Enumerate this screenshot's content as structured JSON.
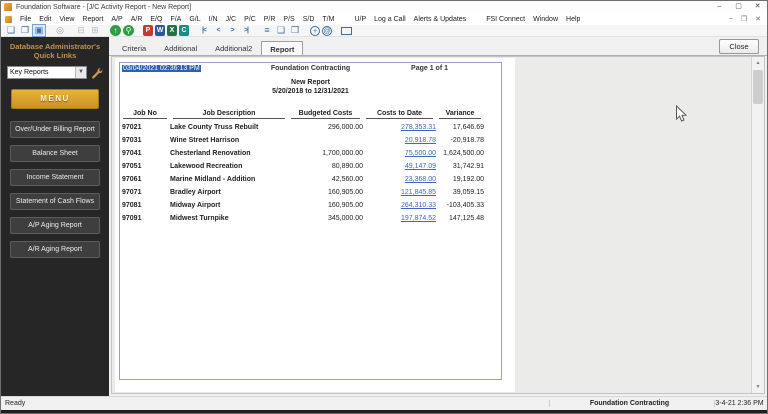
{
  "window": {
    "title": "Foundation Software - [J/C Activity Report - New Report]",
    "controls": {
      "minimize": "–",
      "maximize": "▢",
      "close": "✕"
    },
    "mdi_controls": {
      "minimize": "–",
      "restore": "❐",
      "close": "✕"
    }
  },
  "menubar": {
    "items": [
      "File",
      "Edit",
      "View",
      "Report",
      "A/P",
      "A/R",
      "E/Q",
      "F/A",
      "G/L",
      "I/N",
      "J/C",
      "P/C",
      "P/R",
      "P/S",
      "S/D",
      "T/M",
      "U/P",
      "Log a Call",
      "Alerts & Updates",
      "FSI Connect",
      "Window",
      "Help"
    ]
  },
  "toolbar": {
    "icons": [
      {
        "name": "tile-windows",
        "glyph": "❏",
        "cls": "blue"
      },
      {
        "name": "cascade-windows",
        "glyph": "❐",
        "cls": "blue"
      },
      {
        "name": "active-window",
        "glyph": "▣",
        "cls": "blue sel"
      },
      {
        "name": "tip-lightbulb",
        "glyph": "◎",
        "cls": "gray",
        "gap": true
      },
      {
        "name": "print",
        "glyph": "⊟",
        "cls": "disabled",
        "gap": true
      },
      {
        "name": "print-preview",
        "glyph": "⊞",
        "cls": "disabled"
      },
      {
        "name": "email-report",
        "glyph": "↑",
        "cls": "green-circle",
        "gap": true
      },
      {
        "name": "zoom",
        "glyph": "⚲",
        "cls": "green-circle"
      },
      {
        "name": "export-pdf",
        "glyph": "P",
        "cls": "doc red",
        "gap": true
      },
      {
        "name": "export-word",
        "glyph": "W",
        "cls": "doc blue-doc"
      },
      {
        "name": "export-excel",
        "glyph": "X",
        "cls": "doc green-doc"
      },
      {
        "name": "export-csv",
        "glyph": "C",
        "cls": "doc teal-doc"
      },
      {
        "name": "first-page",
        "glyph": "|<",
        "cls": "nav",
        "gap": true
      },
      {
        "name": "prev-page",
        "glyph": "<",
        "cls": "nav"
      },
      {
        "name": "next-page",
        "glyph": ">",
        "cls": "nav"
      },
      {
        "name": "last-page",
        "glyph": ">|",
        "cls": "nav"
      },
      {
        "name": "report-list",
        "glyph": "≡",
        "cls": "blue",
        "gap": true
      },
      {
        "name": "new-report",
        "glyph": "❑",
        "cls": "blue"
      },
      {
        "name": "report-details",
        "glyph": "❒",
        "cls": "blue"
      },
      {
        "name": "refresh",
        "glyph": "+",
        "cls": "blue-circle",
        "gap": true
      },
      {
        "name": "fsi-connect",
        "glyph": "@",
        "cls": "blue-circle"
      },
      {
        "name": "remote-monitor",
        "glyph": "",
        "cls": "monitor",
        "gap": true
      }
    ]
  },
  "sidebar": {
    "header_line1": "Database Administrator's",
    "header_line2": "Quick Links",
    "dropdown_value": "Key Reports",
    "menu_button_label": "MENU",
    "buttons": [
      "Over/Under Billing Report",
      "Balance Sheet",
      "Income Statement",
      "Statement of Cash Flows",
      "A/P Aging Report",
      "A/R Aging Report"
    ]
  },
  "tabs": {
    "items": [
      "Criteria",
      "Additional",
      "Additional2",
      "Report"
    ],
    "active": "Report"
  },
  "close_button_label": "Close",
  "report": {
    "timestamp": "03/04/2021 02:36:13 PM",
    "company": "Foundation Contracting",
    "page_label": "Page 1 of 1",
    "title": "New Report",
    "date_range": "5/20/2018 to 12/31/2021",
    "columns": [
      "Job No",
      "Job Description",
      "Budgeted Costs",
      "Costs to Date",
      "Variance"
    ],
    "rows": [
      {
        "job_no": "97021",
        "description": "Lake County Truss Rebuilt",
        "budgeted": "296,000.00",
        "costs_to_date": "278,353.31",
        "variance": "17,646.69"
      },
      {
        "job_no": "97031",
        "description": "Wine Street Harrison",
        "budgeted": "",
        "costs_to_date": "20,918.78",
        "variance": "-20,918.78"
      },
      {
        "job_no": "97041",
        "description": "Chesterland Renovation",
        "budgeted": "1,700,000.00",
        "costs_to_date": "75,500.00",
        "variance": "1,624,500.00"
      },
      {
        "job_no": "97051",
        "description": "Lakewood Recreation",
        "budgeted": "80,890.00",
        "costs_to_date": "49,147.09",
        "variance": "31,742.91"
      },
      {
        "job_no": "97061",
        "description": "Marine Midland - Addition",
        "budgeted": "42,560.00",
        "costs_to_date": "23,368.00",
        "variance": "19,192.00"
      },
      {
        "job_no": "97071",
        "description": "Bradley Airport",
        "budgeted": "160,905.00",
        "costs_to_date": "121,845.85",
        "variance": "39,059.15"
      },
      {
        "job_no": "97081",
        "description": "Midway Airport",
        "budgeted": "160,905.00",
        "costs_to_date": "264,310.33",
        "variance": "-103,405.33"
      },
      {
        "job_no": "97091",
        "description": "Midwest Turnpike",
        "budgeted": "345,000.00",
        "costs_to_date": "197,874.52",
        "variance": "147,125.48"
      }
    ]
  },
  "statusbar": {
    "ready": "Ready",
    "company": "Foundation Contracting",
    "datetime": "3-4-21 2:36 PM"
  },
  "colors": {
    "accent_gold": "#d9a62e",
    "sidebar_bg": "#262626",
    "link_blue": "#4067c0",
    "selection_blue": "#2f5fb0"
  }
}
